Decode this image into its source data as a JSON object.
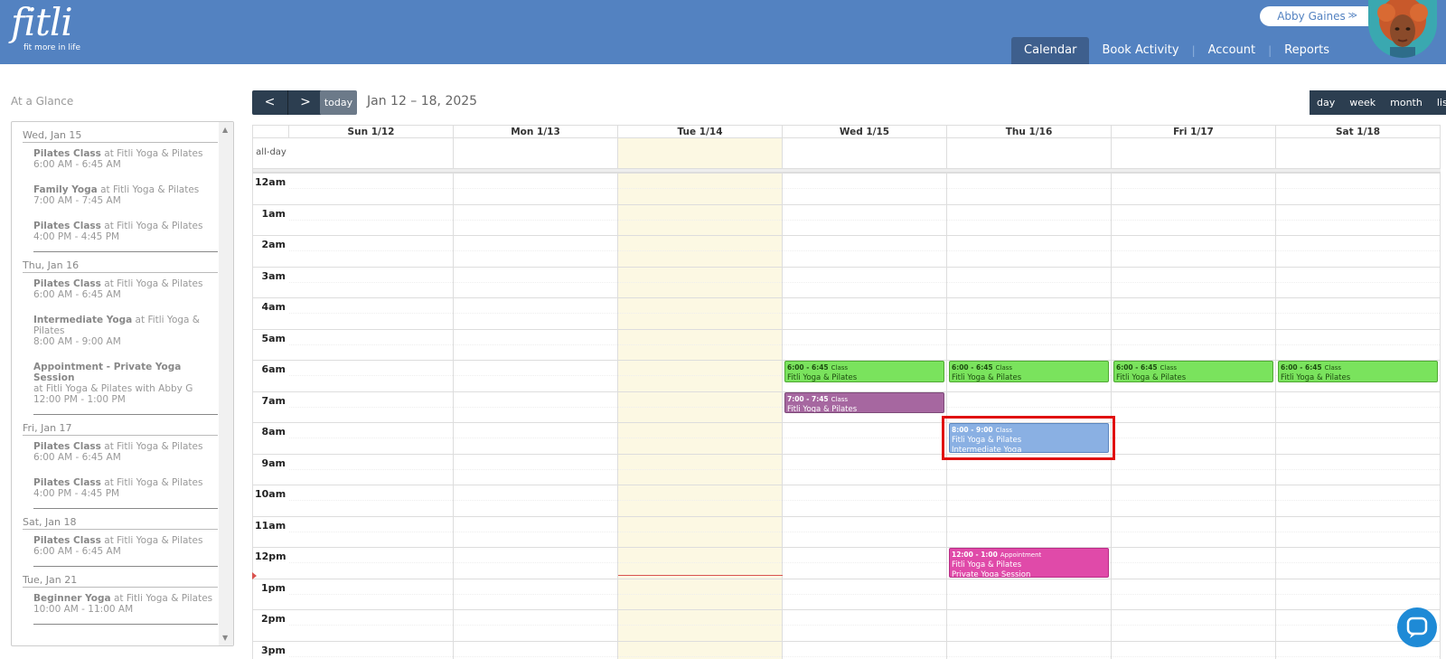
{
  "header": {
    "logo": "fitli",
    "tagline": "fit more in life",
    "user_name": "Abby Gaines",
    "nav": [
      {
        "label": "Calendar",
        "active": true
      },
      {
        "label": "Book Activity"
      },
      {
        "label": "Account"
      },
      {
        "label": "Reports"
      }
    ]
  },
  "sidebar": {
    "title": "At a Glance",
    "days": [
      {
        "date": "Wed, Jan 15",
        "items": [
          {
            "name": "Pilates Class",
            "where": " at Fitli Yoga & Pilates",
            "time": "6:00 AM - 6:45 AM"
          },
          {
            "name": "Family Yoga",
            "where": " at Fitli Yoga & Pilates",
            "time": "7:00 AM - 7:45 AM"
          },
          {
            "name": "Pilates Class",
            "where": " at Fitli Yoga & Pilates",
            "time": "4:00 PM - 4:45 PM"
          }
        ]
      },
      {
        "date": "Thu, Jan 16",
        "items": [
          {
            "name": "Pilates Class",
            "where": " at Fitli Yoga & Pilates",
            "time": "6:00 AM - 6:45 AM"
          },
          {
            "name": "Intermediate Yoga",
            "where": " at Fitli Yoga & Pilates",
            "time": "8:00 AM - 9:00 AM"
          },
          {
            "name": "Appointment - Private Yoga Session",
            "where": "at Fitli Yoga & Pilates with Abby G",
            "time": "12:00 PM - 1:00 PM"
          }
        ]
      },
      {
        "date": "Fri, Jan 17",
        "items": [
          {
            "name": "Pilates Class",
            "where": " at Fitli Yoga & Pilates",
            "time": "6:00 AM - 6:45 AM"
          },
          {
            "name": "Pilates Class",
            "where": " at Fitli Yoga & Pilates",
            "time": "4:00 PM - 4:45 PM"
          }
        ]
      },
      {
        "date": "Sat, Jan 18",
        "items": [
          {
            "name": "Pilates Class",
            "where": " at Fitli Yoga & Pilates",
            "time": "6:00 AM - 6:45 AM"
          }
        ]
      },
      {
        "date": "Tue, Jan 21",
        "items": [
          {
            "name": "Beginner Yoga",
            "where": " at Fitli Yoga & Pilates",
            "time": "10:00 AM - 11:00 AM"
          }
        ]
      }
    ]
  },
  "toolbar": {
    "prev": "<",
    "next": ">",
    "today": "today",
    "range": "Jan 12 – 18, 2025",
    "views": [
      {
        "label": "day"
      },
      {
        "label": "week",
        "active": true
      },
      {
        "label": "month"
      },
      {
        "label": "list"
      }
    ]
  },
  "calendar": {
    "all_day_label": "all-day",
    "days": [
      "Sun 1/12",
      "Mon 1/13",
      "Tue 1/14",
      "Wed 1/15",
      "Thu 1/16",
      "Fri 1/17",
      "Sat 1/18"
    ],
    "today_index": 2,
    "hours": [
      "12am",
      "1am",
      "2am",
      "3am",
      "4am",
      "5am",
      "6am",
      "7am",
      "8am",
      "9am",
      "10am",
      "11am",
      "12pm",
      "1pm",
      "2pm",
      "3pm"
    ],
    "now_hour": 12.9,
    "events": [
      {
        "day": 3,
        "start": 6,
        "end": 6.75,
        "time": "6:00 - 6:45",
        "kind": "Class",
        "lines": [
          "Fitli Yoga & Pilates"
        ],
        "color": "green"
      },
      {
        "day": 4,
        "start": 6,
        "end": 6.75,
        "time": "6:00 - 6:45",
        "kind": "Class",
        "lines": [
          "Fitli Yoga & Pilates"
        ],
        "color": "green"
      },
      {
        "day": 5,
        "start": 6,
        "end": 6.75,
        "time": "6:00 - 6:45",
        "kind": "Class",
        "lines": [
          "Fitli Yoga & Pilates"
        ],
        "color": "green"
      },
      {
        "day": 6,
        "start": 6,
        "end": 6.75,
        "time": "6:00 - 6:45",
        "kind": "Class",
        "lines": [
          "Fitli Yoga & Pilates"
        ],
        "color": "green"
      },
      {
        "day": 3,
        "start": 7,
        "end": 7.75,
        "time": "7:00 - 7:45",
        "kind": "Class",
        "lines": [
          "Fitli Yoga & Pilates"
        ],
        "color": "purple"
      },
      {
        "day": 4,
        "start": 8,
        "end": 9,
        "time": "8:00 - 9:00",
        "kind": "Class",
        "lines": [
          "Fitli Yoga & Pilates",
          "Intermediate Yoga"
        ],
        "color": "blue",
        "highlighted": true
      },
      {
        "day": 4,
        "start": 12,
        "end": 13,
        "time": "12:00 - 1:00",
        "kind": "Appointment",
        "lines": [
          "Fitli Yoga & Pilates",
          "Private Yoga Session"
        ],
        "color": "pink"
      }
    ]
  }
}
